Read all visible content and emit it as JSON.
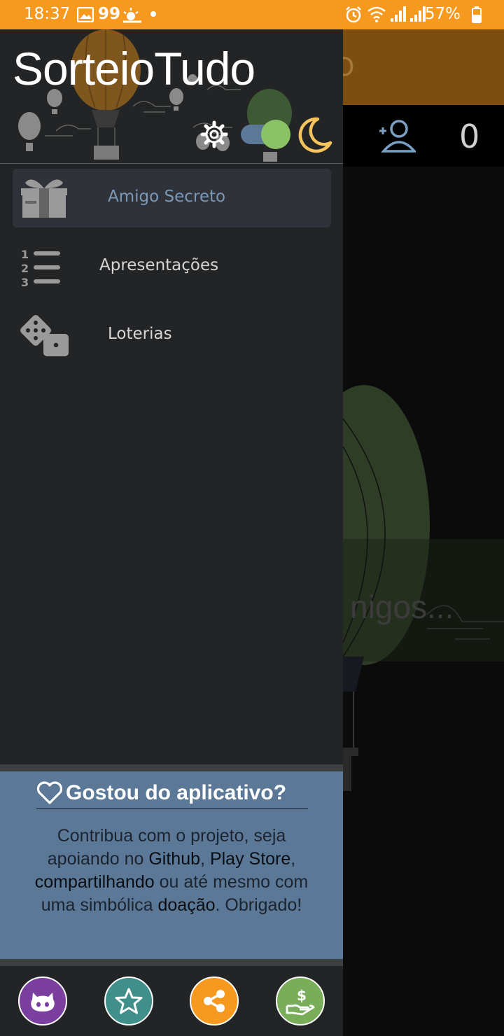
{
  "status_bar": {
    "time": "18:37",
    "battery": "57%",
    "notification_count": "99",
    "icons": [
      "image-icon",
      "sun-cloud-icon",
      "dot-icon",
      "alarm-icon",
      "wifi-icon",
      "signal-icon",
      "signal-icon",
      "battery-icon"
    ]
  },
  "background_app": {
    "appbar_partial_text": "O",
    "participant_count": "0",
    "placeholder_partial": "nigos..."
  },
  "drawer": {
    "title": "SorteioTudo",
    "header_icons": [
      "gear-icon",
      "theme-toggle",
      "moon-icon"
    ],
    "items": [
      {
        "label": "Amigo Secreto",
        "icon": "gift-icon",
        "selected": true
      },
      {
        "label": "Apresentações",
        "icon": "numbered-list-icon",
        "selected": false
      },
      {
        "label": "Loterias",
        "icon": "dice-icon",
        "selected": false
      }
    ],
    "promo": {
      "title": "Gostou do aplicativo?",
      "body_parts": [
        "Contribua com o projeto, seja apoiando no ",
        "Github",
        ", ",
        "Play Store",
        ", ",
        "compartilhando",
        " ou até mesmo com uma simbólica ",
        "doação",
        ". Obrigado!"
      ]
    },
    "bottom_buttons": [
      {
        "icon": "github-icon",
        "color": "#7b3fa0"
      },
      {
        "icon": "star-icon",
        "color": "#3f8f8a"
      },
      {
        "icon": "share-icon",
        "color": "#f7991f"
      },
      {
        "icon": "donate-icon",
        "color": "#7aad5a"
      }
    ]
  },
  "colors": {
    "status_bar": "#f7991f",
    "appbar": "#7e4e10",
    "drawer_bg": "#232426",
    "selected_item_bg": "#2f3239",
    "selected_label": "#7c98b7",
    "promo_bg": "#5b7997"
  }
}
